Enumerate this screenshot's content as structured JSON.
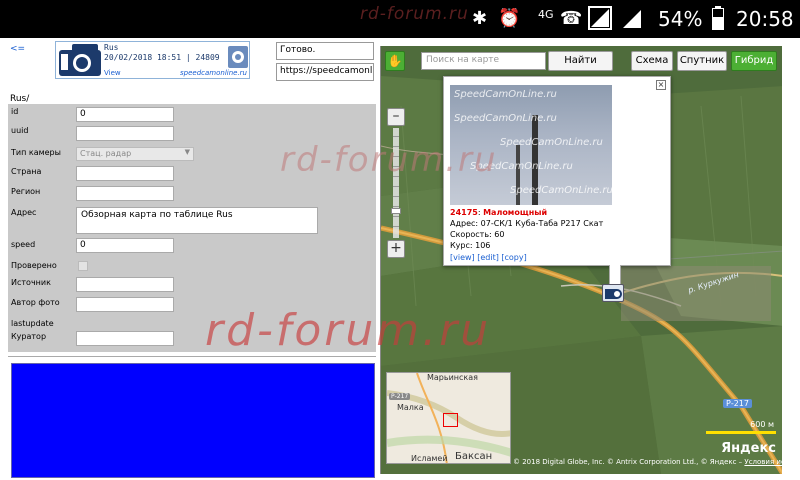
{
  "status_bar": {
    "watermark": "rd-forum.ru",
    "network": "4G",
    "battery": "54%",
    "time": "20:58"
  },
  "header": {
    "back_link": "<=",
    "logo": {
      "line1": "Rus",
      "line2": "20/02/2018 18:51 | 24809",
      "view_link": "View",
      "brand": "speedcamonline.ru"
    },
    "status_value": "Готово.",
    "url_value": "https://speedcamonline.ru"
  },
  "form": {
    "title": "Rus/",
    "fields": {
      "id": {
        "label": "id",
        "value": "0"
      },
      "uuid": {
        "label": "uuid",
        "value": ""
      },
      "camera_type": {
        "label": "Тип камеры",
        "value": "Стац. радар"
      },
      "country": {
        "label": "Страна",
        "value": ""
      },
      "region": {
        "label": "Регион",
        "value": ""
      },
      "address": {
        "label": "Адрес",
        "value": "Обзорная карта по таблице Rus"
      },
      "speed": {
        "label": "speed",
        "value": "0"
      },
      "verified": {
        "label": "Проверено"
      },
      "source": {
        "label": "Источник",
        "value": ""
      },
      "photo_author": {
        "label": "Автор фото",
        "value": ""
      },
      "lastupdate": {
        "label": "lastupdate"
      },
      "curator": {
        "label": "Куратор",
        "value": ""
      }
    }
  },
  "watermarks": {
    "middle": "rd-forum.ru",
    "large": "rd-forum.ru"
  },
  "map": {
    "search_placeholder": "Поиск на карте",
    "find_button": "Найти",
    "types": [
      "Схема",
      "Спутник",
      "Гибрид"
    ],
    "active_type": "Гибрид",
    "popup": {
      "photo_watermark": "SpeedCamOnLine.ru",
      "camera_id": "24175",
      "camera_kind": "Маломощный",
      "address": "Адрес: 07-СК/1 Куба-Таба Р217 Скат",
      "speed": "Скорость: 60",
      "heading": "Курс: 106",
      "links": [
        "[view]",
        "[edit]",
        "[copy]"
      ]
    },
    "river_label": "р. Куркужин",
    "road_label": "Р-217",
    "minimap": {
      "labels": [
        "Марьинская",
        "Малка",
        "Исламей",
        "Баксан"
      ],
      "road": "Р-217"
    },
    "scale": "600 м",
    "provider": "Яндекс",
    "copyright": "© 2018 Digital Globe, Inc. © Antrix Corporation Ltd., © Яндекс –",
    "terms_link": "Условия использования"
  },
  "colors": {
    "green_button": "#4caf34",
    "blue_box": "#0000ff",
    "form_bg": "#c9c9c9"
  }
}
